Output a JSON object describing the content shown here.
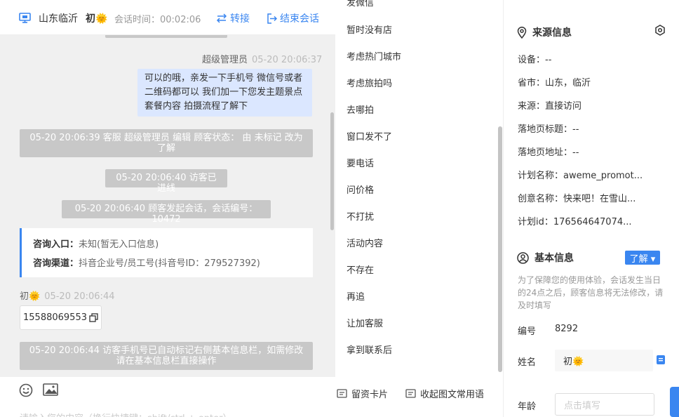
{
  "header": {
    "location": "山东临沂",
    "visitor_name": "初🌞",
    "session_time": "会话时间：00:02:06",
    "transfer_label": "转接",
    "end_label": "结束会话"
  },
  "messages": {
    "agent_sender": "超级管理员",
    "agent_time": "05-20 20:06:37",
    "agent_bubble": "可以的哦，亲发一下手机号 微信号或者二维码都可以 我们加一下您发主题景点套餐内容 拍摄流程了解下",
    "sys_status": "05-20 20:06:39 客服 超级管理员 编辑 顾客状态： 由 未标记 改为 了解",
    "sys_visitor_in": "05-20 20:06:40 访客已进线",
    "sys_session_start": "05-20 20:06:40 顾客发起会话，会话编号：10472",
    "card_entry_label": "咨询入口：",
    "card_entry_value": "未知(暂无入口信息)",
    "card_channel_label": "咨询渠道：",
    "card_channel_value": "抖音企业号/员工号(抖音号ID：279527392)",
    "visitor_sender": "初🌞",
    "visitor_time": "05-20 20:06:44",
    "visitor_phone": "15588069553",
    "sys_phone_marked": "05-20 20:06:44 访客手机号已自动标记右侧基本信息栏，如需修改请在基本信息栏直接操作"
  },
  "input": {
    "placeholder": "请输入您的内容（换行快捷键：shift/ctrl + enter）"
  },
  "quick_replies": {
    "partial_top": "发微信",
    "items": [
      "暂时没有店",
      "考虑热门城市",
      "考虑旅拍吗",
      "去哪拍",
      "窗口发不了",
      "要电话",
      "问价格",
      "不打扰",
      "活动内容",
      "不存在",
      "再追",
      "让加客服",
      "拿到联系后"
    ],
    "footer_card": "留资卡片",
    "footer_rich": "收起图文常用语"
  },
  "source_info": {
    "title": "来源信息",
    "device": "设备：--",
    "province": "省市：山东，临沂",
    "source": "来源：直接访问",
    "landing_title": "落地页标题：--",
    "landing_url": "落地页地址：--",
    "plan_name": "计划名称：aweme_promot...",
    "creative_name": "创意名称：快来吧！在雪山...",
    "plan_id": "计划id：176564647074..."
  },
  "basic_info": {
    "title": "基本信息",
    "status_button": "了解 ▾",
    "notice": "为了保障您的使用体验，会话发生当日的24点之后，顾客信息将无法修改，请及时填写",
    "id_label": "编号",
    "id_value": "8292",
    "name_label": "姓名",
    "name_value": "初🌞",
    "age_label": "年龄",
    "age_placeholder": "点击填写"
  },
  "colors": {
    "accent": "#3a86f0",
    "system_msg_bg": "#c8c8c8",
    "agent_bubble_bg": "#dbe7ff",
    "chat_bg": "#f0f0f0"
  }
}
